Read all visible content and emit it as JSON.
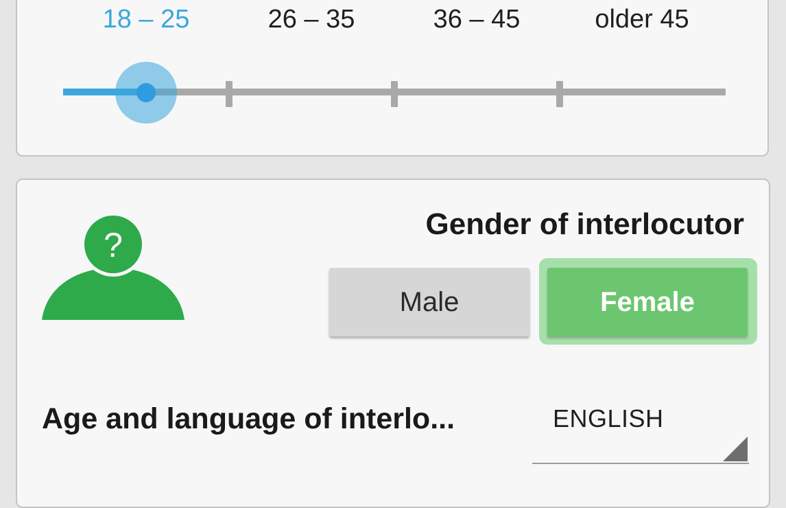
{
  "age_slider": {
    "ranges": [
      "18 – 25",
      "26 – 35",
      "36 – 45",
      "older 45"
    ],
    "selected_index": 0,
    "accent_color": "#3aa6dd"
  },
  "gender": {
    "title": "Gender of interlocutor",
    "icon": "person-question-icon",
    "icon_symbol": "?",
    "icon_color": "#2eaa4a",
    "male_label": "Male",
    "female_label": "Female",
    "selected": "Female",
    "selected_color": "#6cc66f"
  },
  "settings": {
    "age_language_label": "Age and language of interlo...",
    "language_value": "ENGLISH"
  }
}
